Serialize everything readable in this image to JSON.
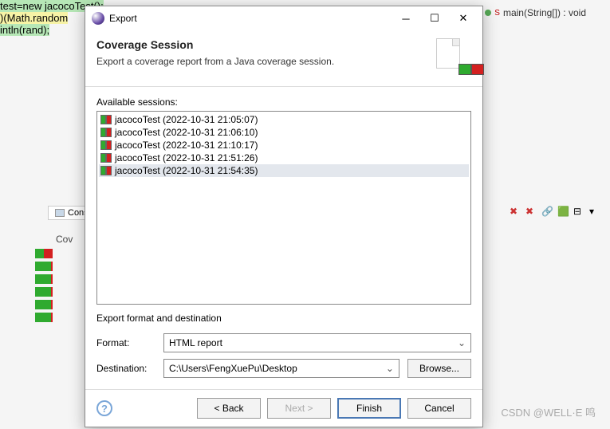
{
  "background": {
    "code_line1": "test=new jacocoTest();",
    "code_line2": ")(Math.random",
    "code_line3": "intln(rand);",
    "outline_item": "main(String[]) : void",
    "console_tab": "Console",
    "coverage_col": "Cov",
    "cov_rows": [
      "1",
      "1"
    ]
  },
  "dialog": {
    "title": "Export",
    "heading": "Coverage Session",
    "description": "Export a coverage report from a Java coverage session.",
    "sessions_label": "Available sessions:",
    "sessions": [
      "jacocoTest (2022-10-31 21:05:07)",
      "jacocoTest (2022-10-31 21:06:10)",
      "jacocoTest (2022-10-31 21:10:17)",
      "jacocoTest (2022-10-31 21:51:26)",
      "jacocoTest (2022-10-31 21:54:35)"
    ],
    "selected_session_index": 4,
    "format_section": "Export format and destination",
    "format_label": "Format:",
    "format_value": "HTML report",
    "dest_label": "Destination:",
    "dest_value": "C:\\Users\\FengXuePu\\Desktop",
    "browse": "Browse...",
    "back": "< Back",
    "next": "Next >",
    "finish": "Finish",
    "cancel": "Cancel"
  },
  "watermark": "CSDN @WELL·E 鸣"
}
